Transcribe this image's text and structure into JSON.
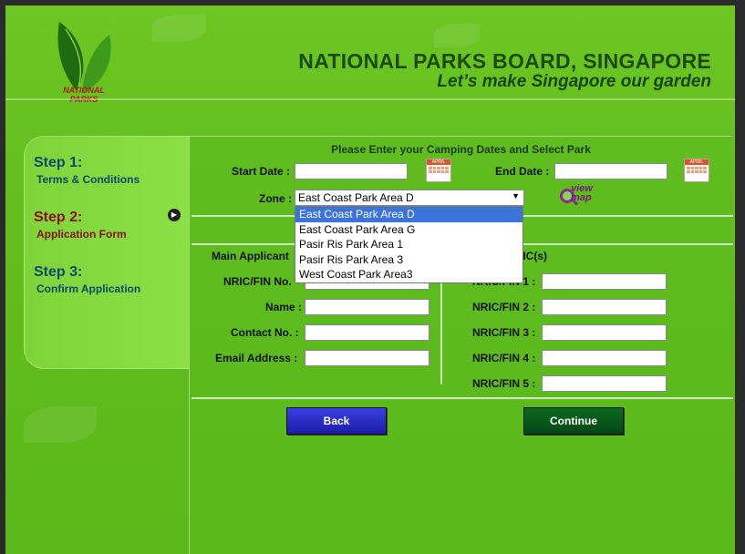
{
  "header": {
    "logo_text": "NATIONAL PARKS",
    "title": "NATIONAL PARKS BOARD, SINGAPORE",
    "tagline": "Let’s make Singapore our garden"
  },
  "steps": [
    {
      "title": "Step 1:",
      "subtitle": "Terms & Conditions",
      "active": false
    },
    {
      "title": "Step 2:",
      "subtitle": "Application Form",
      "active": true
    },
    {
      "title": "Step 3:",
      "subtitle": "Confirm Application",
      "active": false
    }
  ],
  "form": {
    "heading": "Please Enter your Camping Dates and Select Park",
    "start_date_label": "Start Date :",
    "start_date_value": "",
    "end_date_label": "End Date :",
    "end_date_value": "",
    "zone_label": "Zone :",
    "zone_selected": "East Coast Park Area D",
    "zone_options": [
      "East Coast Park Area D",
      "East Coast Park Area G",
      "Pasir Ris Park Area 1",
      "Pasir Ris Park Area 3",
      "West Coast Park Area3"
    ],
    "view_map_label": "view map",
    "calendar_icon_text": "APRIL",
    "main_applicant_heading": "Main Applicant",
    "group_heading": "up NRIC(s)",
    "nric_label": "NRIC/FIN No.",
    "name_label": "Name :",
    "contact_label": "Contact No. :",
    "email_label": "Email Address :",
    "group_nric_labels": [
      "NRIC/FIN 1 :",
      "NRIC/FIN 2 :",
      "NRIC/FIN 3 :",
      "NRIC/FIN 4 :",
      "NRIC/FIN 5 :"
    ],
    "back_label": "Back",
    "continue_label": "Continue"
  },
  "colors": {
    "background": "#61be1d",
    "title_green": "#1d4b0e",
    "active_step": "#8a1010",
    "step_text": "#0b4a6a",
    "back_button": "#1b1ea8",
    "continue_button": "#044615",
    "selected_option": "#3a74d8"
  }
}
